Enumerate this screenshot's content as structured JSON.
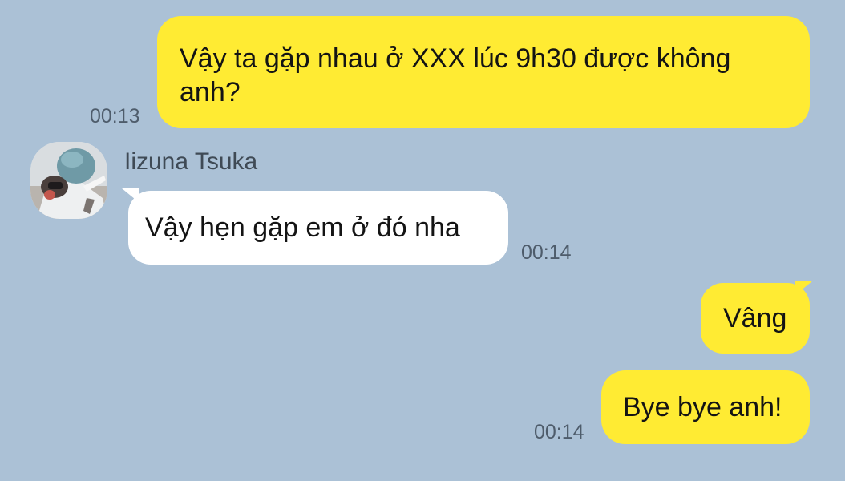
{
  "messages": [
    {
      "direction": "outgoing",
      "text": "Vậy ta gặp nhau ở XXX lúc 9h30 được không anh?",
      "time": "00:13"
    },
    {
      "direction": "incoming",
      "sender": "Iizuna Tsuka",
      "text": "Vậy hẹn gặp em ở đó nha",
      "time": "00:14"
    },
    {
      "direction": "outgoing",
      "text": "Vâng"
    },
    {
      "direction": "outgoing",
      "text": "Bye bye anh!",
      "time": "00:14"
    }
  ],
  "colors": {
    "background": "#abc1d6",
    "outgoing_bubble": "#ffeb33",
    "incoming_bubble": "#ffffff",
    "time_text": "#4e5c6b"
  },
  "icons": {
    "avatar": "profile-photo"
  }
}
